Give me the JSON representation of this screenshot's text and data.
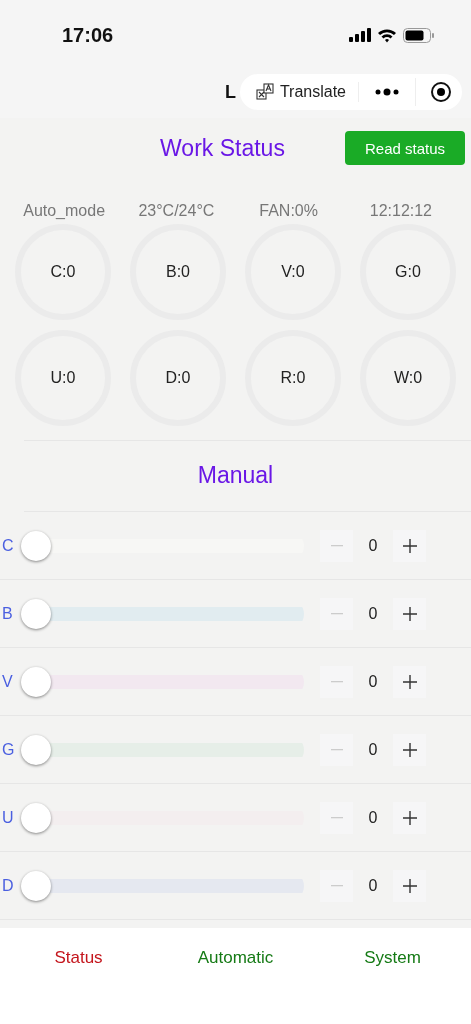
{
  "status_bar": {
    "time": "17:06"
  },
  "capsule": {
    "initial": "L",
    "translate": "Translate"
  },
  "header": {
    "title": "Work Status",
    "button": "Read status"
  },
  "info": [
    "Auto_mode",
    "23°C/24°C",
    "FAN:0%",
    "12:12:12"
  ],
  "gauges": [
    "C:0",
    "B:0",
    "V:0",
    "G:0",
    "U:0",
    "D:0",
    "R:0",
    "W:0"
  ],
  "manual": {
    "title": "Manual",
    "channels": [
      {
        "name": "C",
        "color": "#f7f7f5",
        "level": 0,
        "value": "0"
      },
      {
        "name": "B",
        "color": "#e1ecf0",
        "level": 0,
        "value": "0"
      },
      {
        "name": "V",
        "color": "#f2e8f0",
        "level": 0,
        "value": "0"
      },
      {
        "name": "G",
        "color": "#e6eee8",
        "level": 0,
        "value": "0"
      },
      {
        "name": "U",
        "color": "#f3eeef",
        "level": 0,
        "value": "0"
      },
      {
        "name": "D",
        "color": "#e5e8f0",
        "level": 0,
        "value": "0"
      }
    ]
  },
  "tabs": [
    {
      "label": "Status",
      "selected": true
    },
    {
      "label": "Automatic",
      "selected": false
    },
    {
      "label": "System",
      "selected": false
    }
  ]
}
